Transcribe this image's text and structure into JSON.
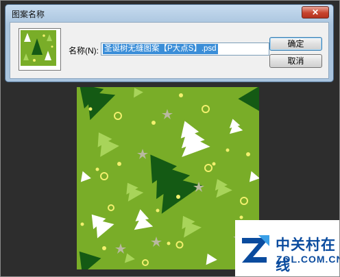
{
  "dialog": {
    "title": "图案名称",
    "close_symbol": "✕",
    "name_label": "名称(N):",
    "name_value": "圣诞树无缝图案【P大点S】.psd",
    "ok_label": "确定",
    "cancel_label": "取消"
  },
  "pattern": {
    "colors": {
      "background": "#79ad28",
      "dark_tree": "#145a14",
      "mid_tree": "#a8d45a",
      "white_tree": "#ffffff",
      "dot": "#f2f06e",
      "star": "#b9b9a0"
    }
  },
  "watermark": {
    "text_line1": "中关村在线",
    "text_line2": "ZOL.COM.CN",
    "logo_icon": "zol-logo-icon"
  }
}
